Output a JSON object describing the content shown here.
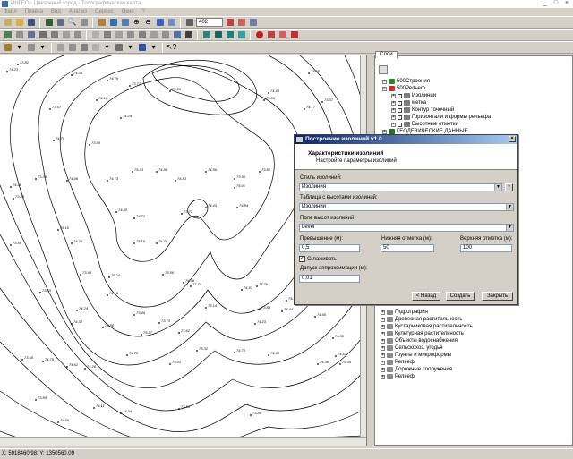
{
  "window": {
    "title": "ИНГЕО - Цветочный город - Топографическая карта"
  },
  "menu": [
    "Файл",
    "Правка",
    "Вид",
    "Анализ",
    "Сервис",
    "Окно",
    "?"
  ],
  "toolbar": {
    "scale_value": "402"
  },
  "layers_panel": {
    "tab_label": "Слои",
    "tree_top": [
      {
        "label": "500Строения",
        "depth": 1,
        "expander": "+"
      },
      {
        "label": "500Рельеф",
        "depth": 1,
        "expander": "−"
      },
      {
        "label": "Изолинии",
        "depth": 2,
        "expander": "+"
      },
      {
        "label": "метка",
        "depth": 2,
        "expander": "+"
      },
      {
        "label": "Контур точечный",
        "depth": 2,
        "expander": "+"
      },
      {
        "label": "Горизонтали и формы рельефа",
        "depth": 2,
        "expander": "+"
      },
      {
        "label": "Высотные отметки",
        "depth": 2,
        "expander": "+"
      },
      {
        "label": "ГЕОДЕЗИЧЕСКИЕ ДАННЫЕ",
        "depth": 1,
        "expander": "+"
      }
    ],
    "tree_bottom": [
      {
        "label": "Гидрография"
      },
      {
        "label": "Древесная растительность"
      },
      {
        "label": "Кустарниковая растительность"
      },
      {
        "label": "Культурная растительность"
      },
      {
        "label": "Объекты водоснабжения"
      },
      {
        "label": "Сельскохоз. угодья"
      },
      {
        "label": "Грунты и микроформы"
      },
      {
        "label": "Рельеф"
      },
      {
        "label": "Дорожные сооружения"
      },
      {
        "label": "Рельеф"
      }
    ]
  },
  "dialog": {
    "title": "Построение изолиний v1.0",
    "header_title": "Характеристики изолиний",
    "header_subtitle": "Настройте параметры изолиний",
    "style_label": "Стиль изолиний:",
    "style_value": "Изолиния",
    "table_label": "Таблица с высотами изолиний:",
    "table_value": "Изолинии",
    "field_label": "Поле высот изолиний:",
    "field_value": "Level",
    "step_label": "Превышение (м):",
    "step_value": "0,5",
    "low_label": "Нижняя отметка (м):",
    "low_value": "50",
    "high_label": "Верхняя отметка (м):",
    "high_value": "100",
    "smooth_label": "Сглаживать",
    "tolerance_label": "Допуск аппроксимации (м):",
    "tolerance_value": "0,01",
    "back_button": "< Назад",
    "create_button": "Создать",
    "close_button": "Закрыть"
  },
  "status": {
    "coords": "X: 5918460,98; Y: 1350560,09"
  },
  "map": {
    "elevation_labels": [
      "74.23",
      "73.81",
      "74.38",
      "74.79",
      "73.71",
      "74.12",
      "73.57",
      "74.24",
      "73.96",
      "74.48",
      "75.09",
      "74.60",
      "73.37",
      "74.17",
      "73.90",
      "74.79",
      "74.46",
      "73.35",
      "74.48",
      "73.43",
      "75.23",
      "74.90",
      "74.73",
      "74.56",
      "73.95",
      "74.83",
      "75.01",
      "73.81",
      "74.80",
      "74.72",
      "73.71",
      "74.43",
      "74.84",
      "73.56",
      "75.10",
      "74.26",
      "75.15",
      "74.76",
      "73.98",
      "75.24",
      "73.33",
      "73.56",
      "74.76",
      "73.71",
      "74.57",
      "73.76",
      "75.13",
      "74.15",
      "74.16",
      "74.24",
      "73.44",
      "73.73",
      "73.14",
      "73.84",
      "74.44",
      "74.32",
      "73.88",
      "75.27",
      "74.62",
      "74.23",
      "74.65",
      "74.38",
      "74.57",
      "75.34",
      "73.32",
      "74.78",
      "74.30",
      "73.65",
      "74.75",
      "74.61",
      "74.26",
      "74.78",
      "75.03",
      "74.38",
      "73.89",
      "74.56",
      "74.11",
      "74.34",
      "73.53",
      "73.80"
    ]
  }
}
